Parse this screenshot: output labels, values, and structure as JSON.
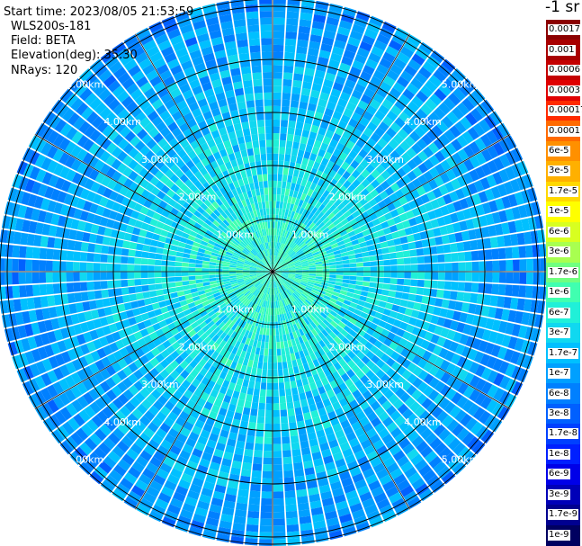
{
  "info": {
    "start_time": "Start time: 2023/08/05 21:53:59",
    "instrument": "WLS200s-181",
    "field": "Field: BETA",
    "elevation": "Elevation(deg): 35.30",
    "nrays": "NRays: 120"
  },
  "colorbar": {
    "unit": "-1 sr",
    "levels": [
      "0.0017",
      "0.001",
      "0.0006",
      "0.0003",
      "0.00017",
      "0.0001",
      "6e-5",
      "3e-5",
      "1.7e-5",
      "1e-5",
      "6e-6",
      "3e-6",
      "1.7e-6",
      "1e-6",
      "6e-7",
      "3e-7",
      "1.7e-7",
      "1e-7",
      "6e-8",
      "3e-8",
      "1.7e-8",
      "1e-8",
      "6e-9",
      "3e-9",
      "1.7e-9",
      "1e-9"
    ],
    "colors": [
      "#8b0000",
      "#a80000",
      "#c40000",
      "#e00000",
      "#ff2a00",
      "#ff6a00",
      "#ff9000",
      "#ffb000",
      "#ffd800",
      "#ffff00",
      "#d8ff20",
      "#a8ff50",
      "#70ff80",
      "#40ffb0",
      "#20f0d8",
      "#10d8f0",
      "#00c0ff",
      "#00a0ff",
      "#0080ff",
      "#0060ff",
      "#0040ff",
      "#0020ff",
      "#0000e8",
      "#0000b8",
      "#000090",
      "#000060"
    ]
  },
  "chart_data": {
    "type": "heatmap",
    "subtype": "polar-ppi",
    "nrays": 120,
    "range_rings_km": [
      1,
      2,
      3,
      4,
      5
    ],
    "range_labels": [
      "1.00km",
      "2.00km",
      "3.00km",
      "4.00km",
      "5.00km"
    ],
    "spokes_deg_step": 30,
    "value_range": [
      1e-09,
      0.0017
    ],
    "dominant_near_range": "1.7e-7 to 6e-7",
    "dominant_far_range": "6e-8 to 1.7e-7"
  }
}
